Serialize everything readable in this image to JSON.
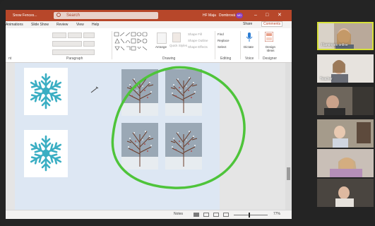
{
  "app": {
    "document_name": "Snow Fences...",
    "search_placeholder": "Search",
    "file_label": "HF Maja",
    "user_name": "Dombrová",
    "user_initials": "MD",
    "minimize": "–",
    "maximize": "□",
    "close": "✕"
  },
  "tabs": [
    "Animations",
    "Slide Show",
    "Review",
    "View",
    "Help"
  ],
  "share_label": "Share",
  "comments_label": "Comments",
  "ribbon": {
    "groups": [
      "Paragraph",
      "Drawing",
      "Editing",
      "Voice",
      "Designer"
    ],
    "font_group_hint": "nt",
    "arrange": "Arrange",
    "quick_styles": "Quick Styles",
    "shape_fill": "Shape Fill",
    "shape_outline": "Shape Outline",
    "shape_effects": "Shape Effects",
    "find": "Find",
    "replace": "Replace",
    "select": "Select",
    "dictate": "Dictate",
    "design_ideas": "Design Ideas"
  },
  "status": {
    "notes": "Notes",
    "zoom": "77%"
  },
  "participants": [
    {
      "label": "Flamingos online",
      "active": true
    },
    {
      "label": "Teacher",
      "active": false
    },
    {
      "label": "",
      "active": false
    },
    {
      "label": "",
      "active": false
    },
    {
      "label": "",
      "active": false
    },
    {
      "label": "",
      "active": false
    }
  ],
  "colors": {
    "powerpoint_red": "#b7472a",
    "annotation_green": "#4ec43a",
    "active_speaker": "#d7e13a",
    "snowflake": "#39aec4"
  }
}
